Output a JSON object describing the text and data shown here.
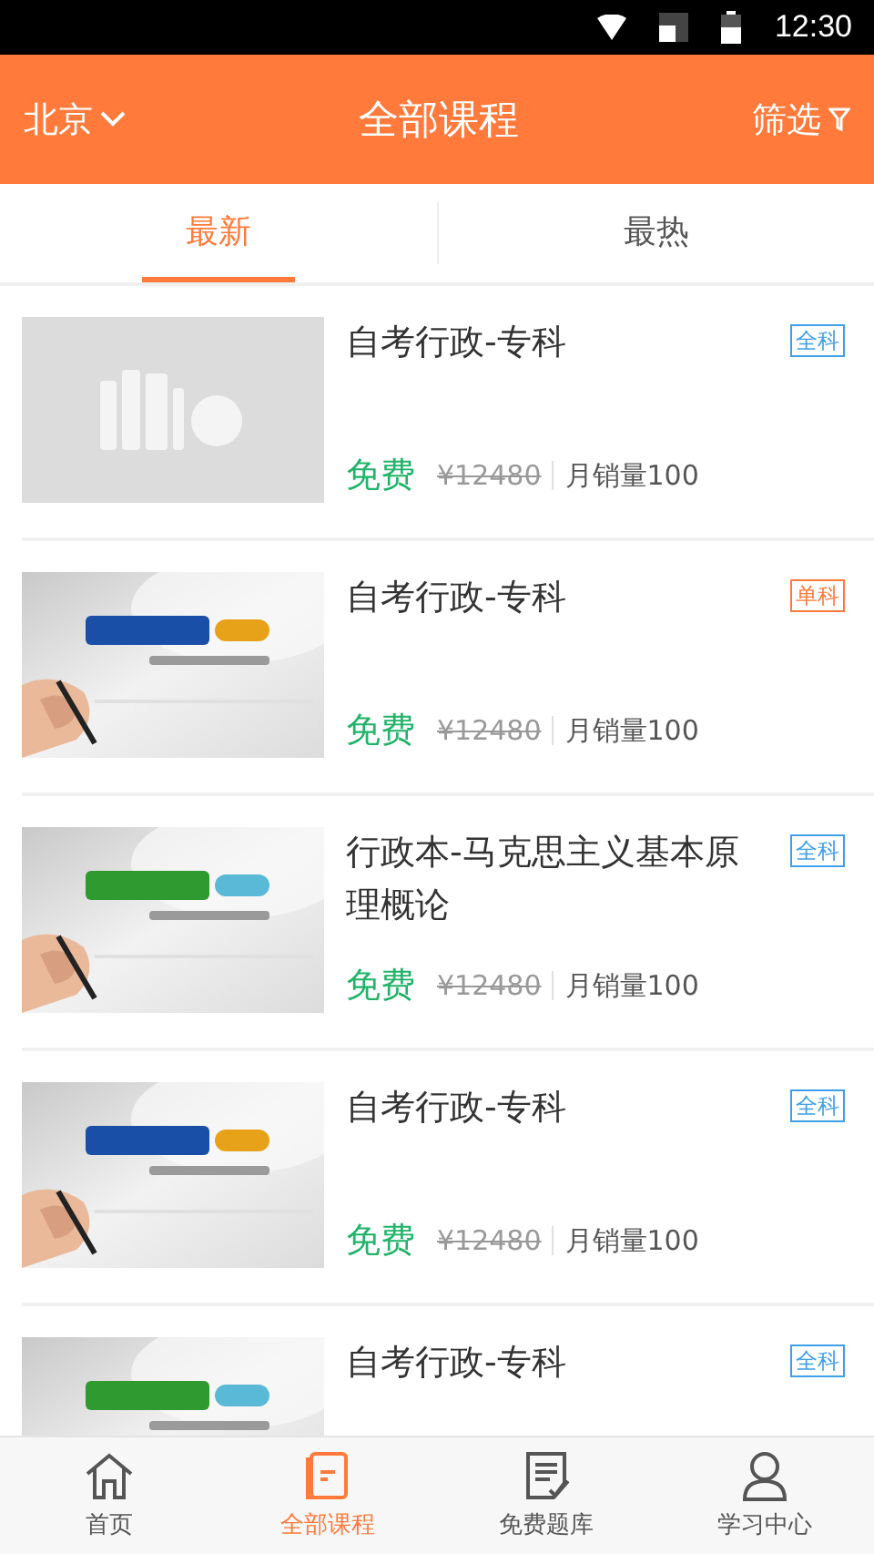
{
  "status_bar": {
    "time": "12:30"
  },
  "header": {
    "city": "北京",
    "title": "全部课程",
    "filter": "筛选"
  },
  "tabs": [
    {
      "label": "最新",
      "selected": true
    },
    {
      "label": "最热",
      "selected": false
    }
  ],
  "courses": [
    {
      "kind": "placeholder",
      "title": "自考行政-专科",
      "tag": {
        "text": "全科",
        "color": "#3ea0e8"
      },
      "price": "免费",
      "original_price": "¥12480",
      "sales": "月销量100"
    },
    {
      "kind": "picture",
      "title": "自考行政-专科",
      "tag": {
        "text": "单科",
        "color": "#ff7a3a"
      },
      "price": "免费",
      "original_price": "¥12480",
      "sales": "月销量100"
    },
    {
      "kind": "picture",
      "title": "行政本-马克思主义基本原理概论",
      "tag": {
        "text": "全科",
        "color": "#3ea0e8"
      },
      "price": "免费",
      "original_price": "¥12480",
      "sales": "月销量100"
    },
    {
      "kind": "picture",
      "title": "自考行政-专科",
      "tag": {
        "text": "全科",
        "color": "#3ea0e8"
      },
      "price": "免费",
      "original_price": "¥12480",
      "sales": "月销量100"
    },
    {
      "kind": "picture",
      "title": "自考行政-专科",
      "tag": {
        "text": "全科",
        "color": "#3ea0e8"
      }
    }
  ],
  "bottom_nav": [
    {
      "label": "首页",
      "selected": false
    },
    {
      "label": "全部课程",
      "selected": true
    },
    {
      "label": "免费题库",
      "selected": false
    },
    {
      "label": "学习中心",
      "selected": false
    }
  ]
}
